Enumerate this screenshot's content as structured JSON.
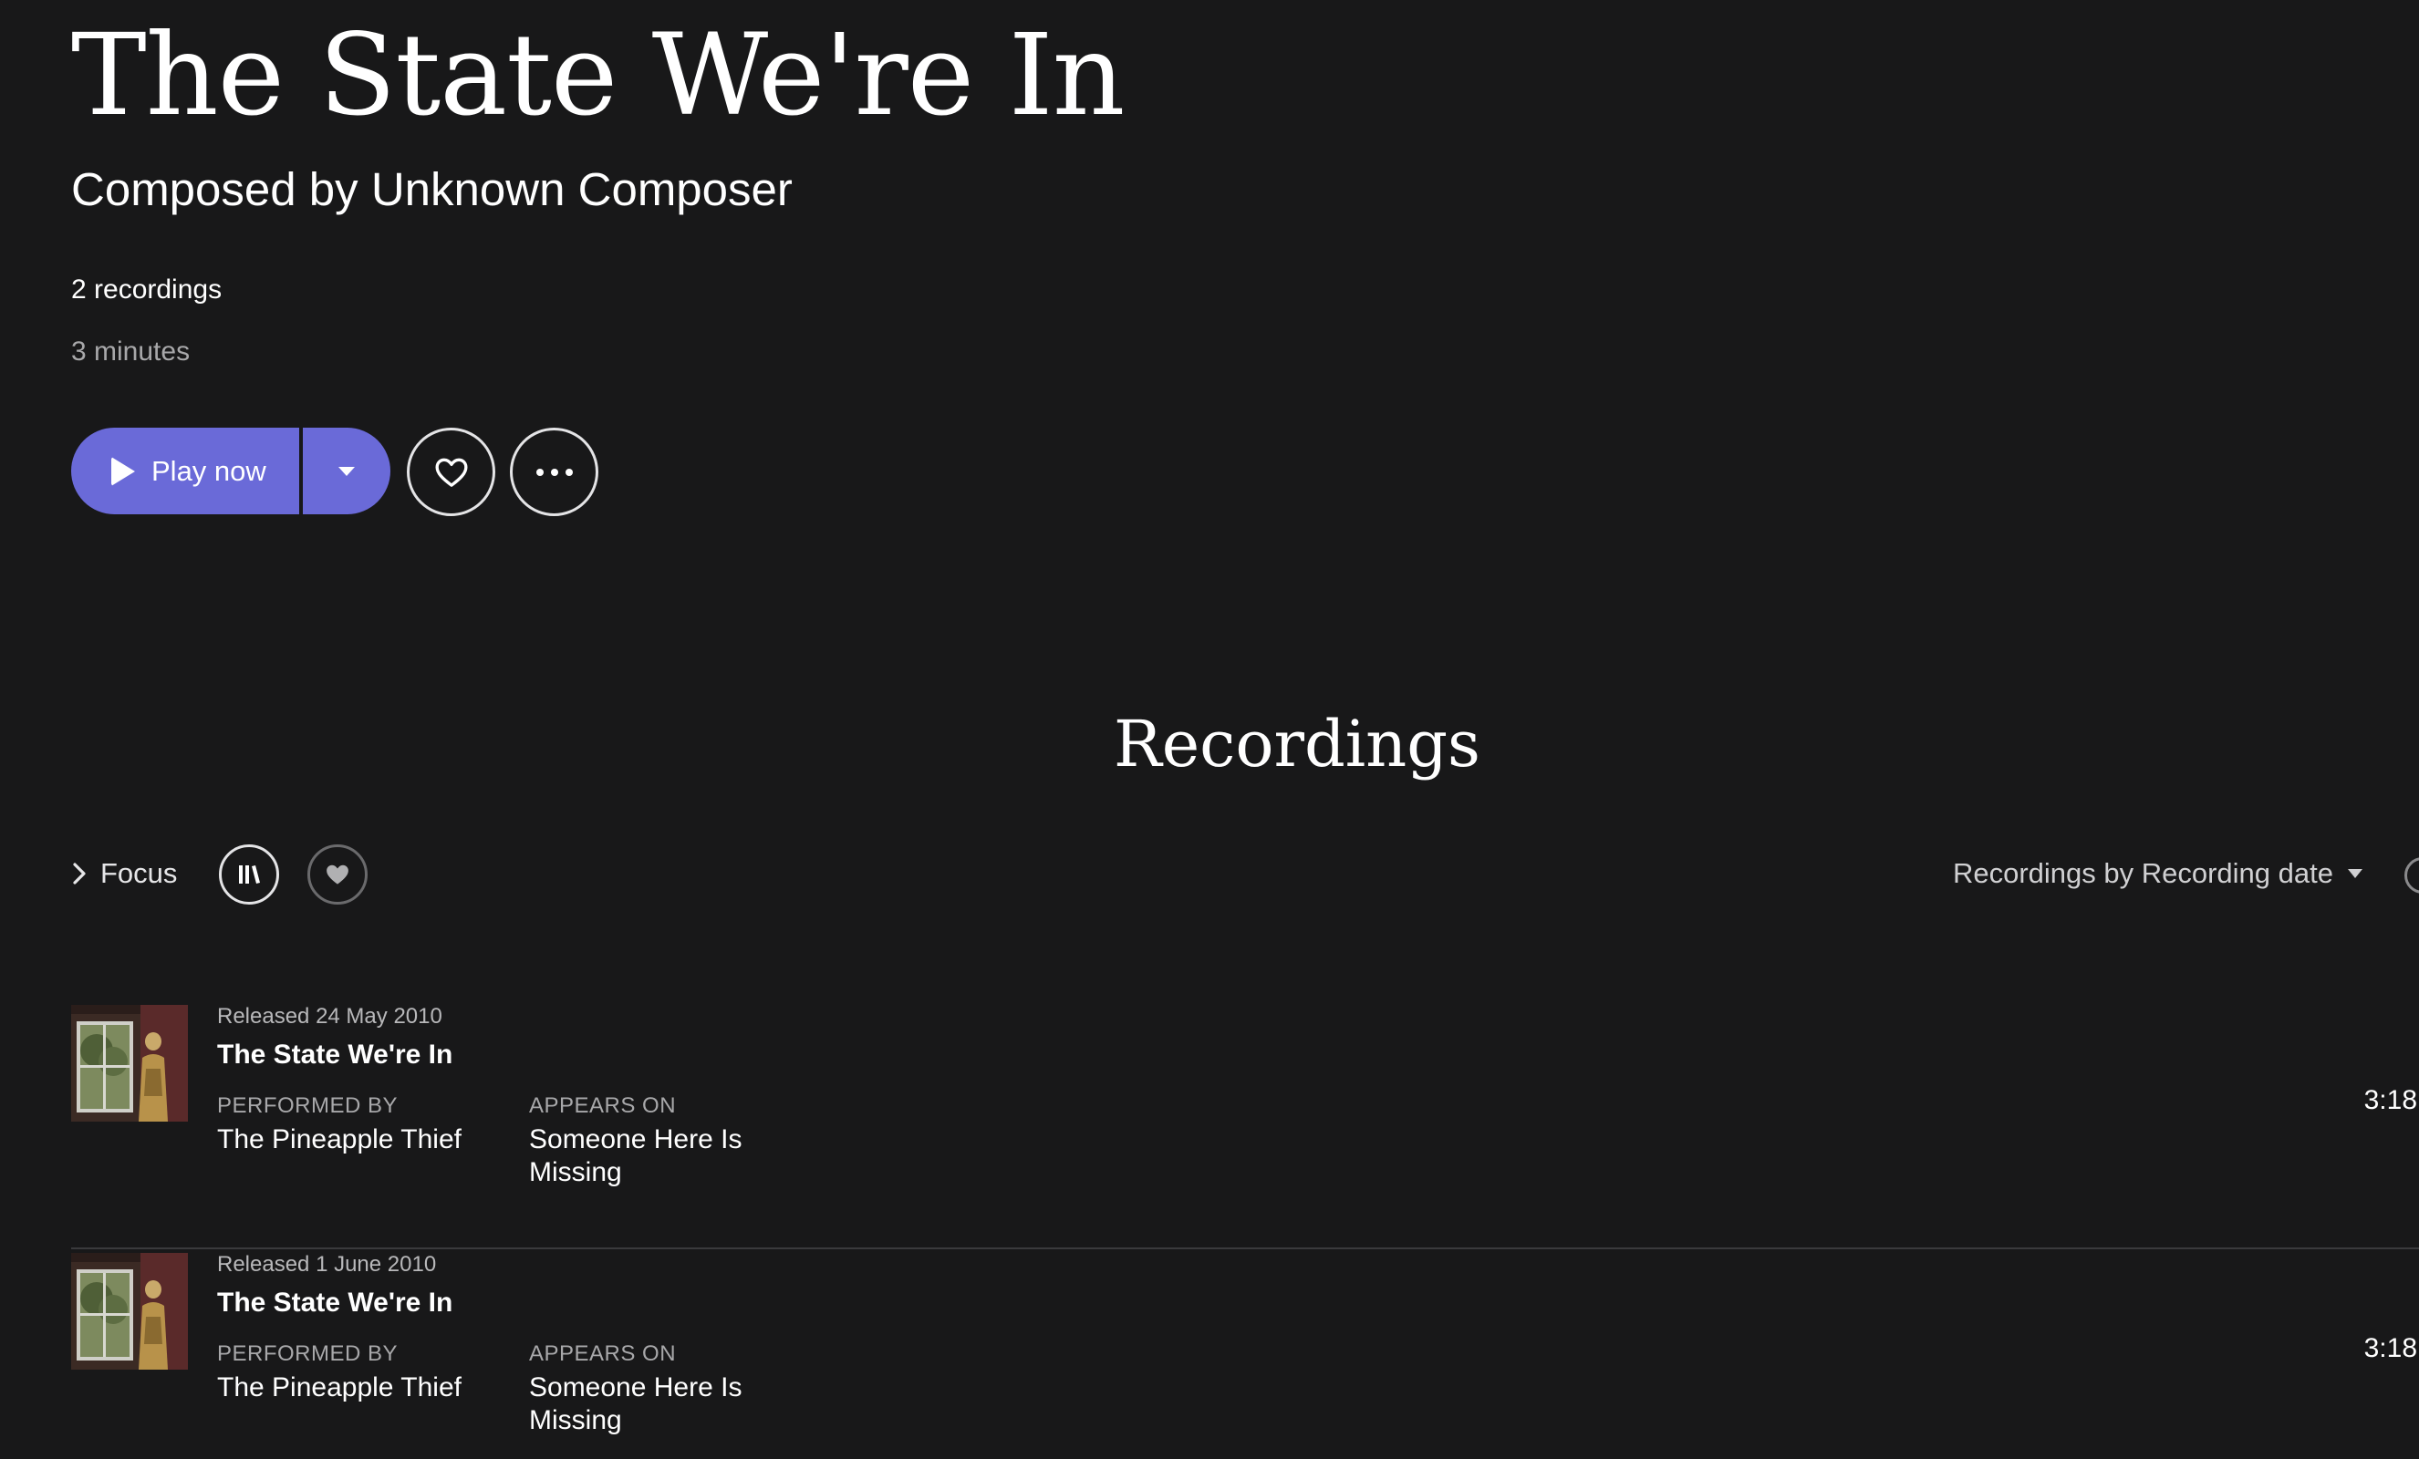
{
  "work": {
    "title": "The State We're In",
    "composer_line": "Composed by Unknown Composer",
    "recording_count": "2 recordings",
    "duration": "3 minutes"
  },
  "actions": {
    "play_label": "Play now"
  },
  "recordings_section": {
    "title": "Recordings",
    "focus_label": "Focus",
    "sort_label": "Recordings by Recording date"
  },
  "recordings": [
    {
      "released": "Released 24 May 2010",
      "title": "The State We're In",
      "performed_by_label": "PERFORMED BY",
      "performed_by": "The Pineapple Thief",
      "appears_on_label": "APPEARS ON",
      "appears_on": "Someone Here Is Missing",
      "duration": "3:18"
    },
    {
      "released": "Released 1 June 2010",
      "title": "The State We're In",
      "performed_by_label": "PERFORMED BY",
      "performed_by": "The Pineapple Thief",
      "appears_on_label": "APPEARS ON",
      "appears_on": "Someone Here Is Missing",
      "duration": "3:18"
    }
  ],
  "colors": {
    "background": "#181819",
    "accent": "#6a6ad8",
    "muted_text": "#a8a8aa"
  },
  "icons": [
    "play-icon",
    "chevron-down-icon",
    "heart-outline-icon",
    "more-icon",
    "chevron-right-icon",
    "library-icon",
    "heart-filled-icon"
  ]
}
